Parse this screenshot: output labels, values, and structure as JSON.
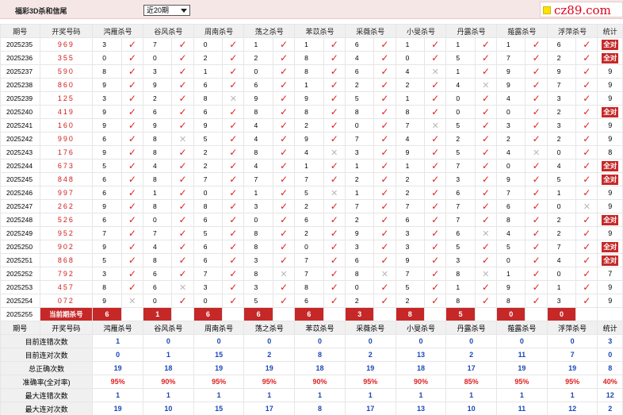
{
  "title": "福彩3D杀和信尾",
  "period_select": {
    "value": "近20期"
  },
  "logo": {
    "text": "cz89.com"
  },
  "columns": {
    "issue": "期号",
    "win": "开奖号码",
    "tally": "统计",
    "predictors": [
      "鸿雁杀号",
      "谷风杀号",
      "周南杀号",
      "荡之杀号",
      "苯苡杀号",
      "采薇杀号",
      "小旻杀号",
      "丹露杀号",
      "薤露杀号",
      "浮萍杀号"
    ]
  },
  "rows": [
    {
      "issue": "2025235",
      "win": "969",
      "kills": [
        "3",
        "7",
        "0",
        "1",
        "1",
        "6",
        "1",
        "1",
        "1",
        "6"
      ],
      "ok": [
        1,
        1,
        1,
        1,
        1,
        1,
        1,
        1,
        1,
        1
      ],
      "tally": "全对"
    },
    {
      "issue": "2025236",
      "win": "355",
      "kills": [
        "0",
        "0",
        "2",
        "2",
        "8",
        "4",
        "0",
        "5",
        "7",
        "2"
      ],
      "ok": [
        1,
        1,
        1,
        1,
        1,
        1,
        1,
        1,
        1,
        1
      ],
      "tally": "全对"
    },
    {
      "issue": "2025237",
      "win": "590",
      "kills": [
        "8",
        "3",
        "1",
        "0",
        "8",
        "6",
        "4",
        "1",
        "9",
        "9"
      ],
      "ok": [
        1,
        1,
        1,
        1,
        1,
        1,
        0,
        1,
        1,
        1
      ],
      "tally": "9"
    },
    {
      "issue": "2025238",
      "win": "860",
      "kills": [
        "9",
        "9",
        "6",
        "6",
        "1",
        "2",
        "2",
        "4",
        "9",
        "7"
      ],
      "ok": [
        1,
        1,
        1,
        1,
        1,
        1,
        1,
        0,
        1,
        1
      ],
      "tally": "9"
    },
    {
      "issue": "2025239",
      "win": "125",
      "kills": [
        "3",
        "2",
        "8",
        "9",
        "9",
        "5",
        "1",
        "0",
        "4",
        "3"
      ],
      "ok": [
        1,
        1,
        0,
        1,
        1,
        1,
        1,
        1,
        1,
        1
      ],
      "tally": "9"
    },
    {
      "issue": "2025240",
      "win": "419",
      "kills": [
        "9",
        "6",
        "6",
        "8",
        "8",
        "8",
        "8",
        "0",
        "0",
        "2"
      ],
      "ok": [
        1,
        1,
        1,
        1,
        1,
        1,
        1,
        1,
        1,
        1
      ],
      "tally": "全对"
    },
    {
      "issue": "2025241",
      "win": "160",
      "kills": [
        "9",
        "9",
        "9",
        "4",
        "2",
        "0",
        "7",
        "5",
        "3",
        "3"
      ],
      "ok": [
        1,
        1,
        1,
        1,
        1,
        1,
        0,
        1,
        1,
        1
      ],
      "tally": "9"
    },
    {
      "issue": "2025242",
      "win": "990",
      "kills": [
        "6",
        "8",
        "5",
        "4",
        "9",
        "7",
        "4",
        "2",
        "2",
        "2"
      ],
      "ok": [
        1,
        0,
        1,
        1,
        1,
        1,
        1,
        1,
        1,
        1
      ],
      "tally": "9"
    },
    {
      "issue": "2025243",
      "win": "176",
      "kills": [
        "9",
        "8",
        "2",
        "8",
        "4",
        "3",
        "9",
        "5",
        "4",
        "0"
      ],
      "ok": [
        1,
        1,
        1,
        1,
        0,
        1,
        1,
        1,
        0,
        1
      ],
      "tally": "8"
    },
    {
      "issue": "2025244",
      "win": "673",
      "kills": [
        "5",
        "4",
        "2",
        "4",
        "1",
        "1",
        "1",
        "7",
        "0",
        "4"
      ],
      "ok": [
        1,
        1,
        1,
        1,
        1,
        1,
        1,
        1,
        1,
        1
      ],
      "tally": "全对"
    },
    {
      "issue": "2025245",
      "win": "848",
      "kills": [
        "6",
        "8",
        "7",
        "7",
        "7",
        "2",
        "2",
        "3",
        "9",
        "5"
      ],
      "ok": [
        1,
        1,
        1,
        1,
        1,
        1,
        1,
        1,
        1,
        1
      ],
      "tally": "全对"
    },
    {
      "issue": "2025246",
      "win": "997",
      "kills": [
        "6",
        "1",
        "0",
        "1",
        "5",
        "1",
        "2",
        "6",
        "7",
        "1"
      ],
      "ok": [
        1,
        1,
        1,
        1,
        0,
        1,
        1,
        1,
        1,
        1
      ],
      "tally": "9"
    },
    {
      "issue": "2025247",
      "win": "262",
      "kills": [
        "9",
        "8",
        "8",
        "3",
        "2",
        "7",
        "7",
        "7",
        "6",
        "0"
      ],
      "ok": [
        1,
        1,
        1,
        1,
        1,
        1,
        1,
        1,
        1,
        0
      ],
      "tally": "9"
    },
    {
      "issue": "2025248",
      "win": "526",
      "kills": [
        "6",
        "0",
        "6",
        "0",
        "6",
        "2",
        "6",
        "7",
        "8",
        "2"
      ],
      "ok": [
        1,
        1,
        1,
        1,
        1,
        1,
        1,
        1,
        1,
        1
      ],
      "tally": "全对"
    },
    {
      "issue": "2025249",
      "win": "952",
      "kills": [
        "7",
        "7",
        "5",
        "8",
        "2",
        "9",
        "3",
        "6",
        "4",
        "2"
      ],
      "ok": [
        1,
        1,
        1,
        1,
        1,
        1,
        1,
        0,
        1,
        1
      ],
      "tally": "9"
    },
    {
      "issue": "2025250",
      "win": "902",
      "kills": [
        "9",
        "4",
        "6",
        "8",
        "0",
        "3",
        "3",
        "5",
        "5",
        "7"
      ],
      "ok": [
        1,
        1,
        1,
        1,
        1,
        1,
        1,
        1,
        1,
        1
      ],
      "tally": "全对"
    },
    {
      "issue": "2025251",
      "win": "868",
      "kills": [
        "5",
        "8",
        "6",
        "3",
        "7",
        "6",
        "9",
        "3",
        "0",
        "4"
      ],
      "ok": [
        1,
        1,
        1,
        1,
        1,
        1,
        1,
        1,
        1,
        1
      ],
      "tally": "全对"
    },
    {
      "issue": "2025252",
      "win": "792",
      "kills": [
        "3",
        "6",
        "7",
        "8",
        "7",
        "8",
        "7",
        "8",
        "1",
        "0"
      ],
      "ok": [
        1,
        1,
        1,
        0,
        1,
        0,
        1,
        0,
        1,
        1
      ],
      "tally": "7"
    },
    {
      "issue": "2025253",
      "win": "457",
      "kills": [
        "8",
        "6",
        "3",
        "3",
        "8",
        "0",
        "5",
        "1",
        "9",
        "1"
      ],
      "ok": [
        1,
        0,
        1,
        1,
        1,
        1,
        1,
        1,
        1,
        1
      ],
      "tally": "9"
    },
    {
      "issue": "2025254",
      "win": "072",
      "kills": [
        "9",
        "0",
        "0",
        "5",
        "6",
        "2",
        "2",
        "8",
        "8",
        "3"
      ],
      "ok": [
        0,
        1,
        1,
        1,
        1,
        1,
        1,
        1,
        1,
        1
      ],
      "tally": "9"
    }
  ],
  "current": {
    "issue": "2025255",
    "label": "当前期杀号",
    "kills": [
      "6",
      "1",
      "6",
      "6",
      "6",
      "3",
      "8",
      "5",
      "0",
      "0"
    ]
  },
  "marks": {
    "ok": "✓",
    "bad": "✕"
  },
  "stats": [
    {
      "label": "目前连错次数",
      "values": [
        "1",
        "0",
        "0",
        "0",
        "0",
        "0",
        "0",
        "0",
        "0",
        "0"
      ],
      "tally": "3"
    },
    {
      "label": "目前连对次数",
      "values": [
        "0",
        "1",
        "15",
        "2",
        "8",
        "2",
        "13",
        "2",
        "11",
        "7"
      ],
      "tally": "0"
    },
    {
      "label": "总正确次数",
      "values": [
        "19",
        "18",
        "19",
        "19",
        "18",
        "19",
        "18",
        "17",
        "19",
        "19"
      ],
      "tally": "8"
    },
    {
      "label": "准确率(全对率)",
      "values": [
        "95%",
        "90%",
        "95%",
        "95%",
        "90%",
        "95%",
        "90%",
        "85%",
        "95%",
        "95%"
      ],
      "tally": "40%",
      "red": true
    },
    {
      "label": "最大连错次数",
      "values": [
        "1",
        "1",
        "1",
        "1",
        "1",
        "1",
        "1",
        "1",
        "1",
        "1"
      ],
      "tally": "12"
    },
    {
      "label": "最大连对次数",
      "values": [
        "19",
        "10",
        "15",
        "17",
        "8",
        "17",
        "13",
        "10",
        "11",
        "12"
      ],
      "tally": "2"
    }
  ]
}
